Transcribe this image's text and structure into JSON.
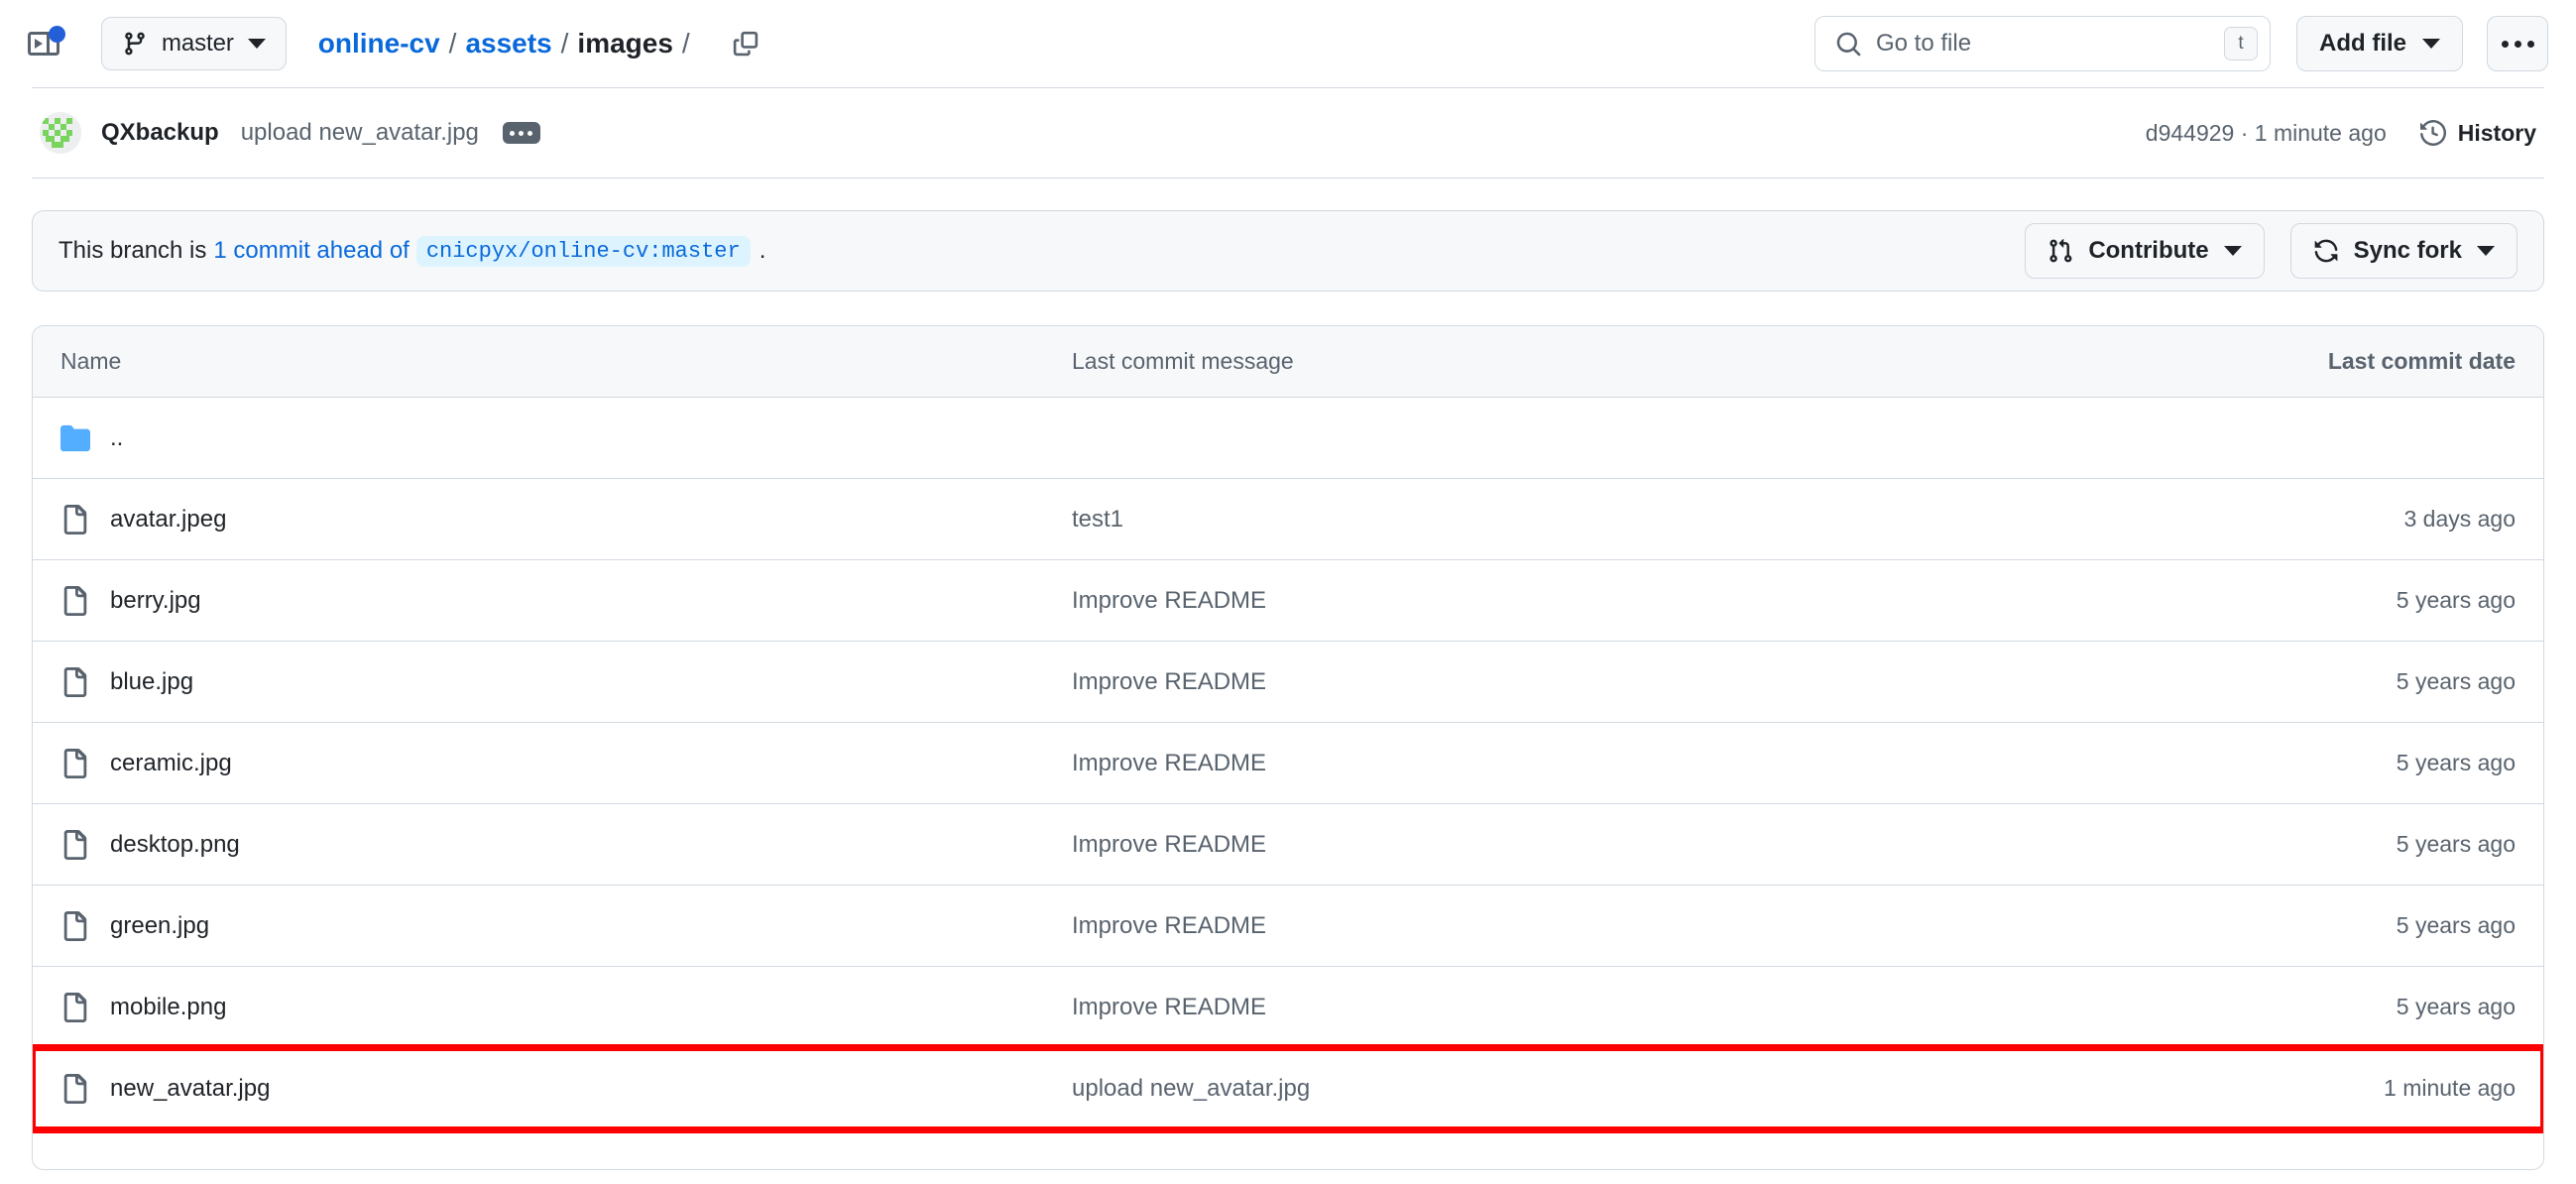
{
  "topbar": {
    "sidebar_toggle_icon": "sidebar-expand-icon",
    "notification_dot_color": "#2360d8",
    "branch": {
      "icon": "git-branch-icon",
      "label": "master"
    },
    "breadcrumb": {
      "parts": [
        {
          "label": "online-cv",
          "type": "link"
        },
        {
          "label": "assets",
          "type": "link"
        },
        {
          "label": "images",
          "type": "current"
        }
      ],
      "separator": "/",
      "trailing_separator": "/"
    },
    "copy_path_icon": "copy-icon",
    "search": {
      "icon": "search-icon",
      "placeholder": "Go to file",
      "shortcut_key": "t"
    },
    "add_file": {
      "label": "Add file",
      "caret_icon": "chevron-down-icon"
    },
    "more_label": "•••"
  },
  "commit": {
    "avatar_alt": "QXbackup avatar identicon",
    "author": "QXbackup",
    "message": "upload new_avatar.jpg",
    "expand_icon": "ellipsis-icon",
    "hash": "d944929",
    "separator": "·",
    "relative_time": "1 minute ago",
    "meta": "d944929 · 1 minute ago",
    "history": {
      "icon": "history-icon",
      "label": "History"
    }
  },
  "banner": {
    "prefix": "This branch is",
    "ahead_link": "1 commit ahead of",
    "upstream": "cnicpyx/online-cv:master",
    "suffix": ".",
    "contribute": {
      "icon": "git-pull-request-icon",
      "label": "Contribute",
      "caret_icon": "chevron-down-icon"
    },
    "sync_fork": {
      "icon": "sync-icon",
      "label": "Sync fork",
      "caret_icon": "chevron-down-icon"
    }
  },
  "filetable": {
    "headers": {
      "name": "Name",
      "message": "Last commit message",
      "date": "Last commit date"
    },
    "rows": [
      {
        "icon": "folder-icon",
        "name": "..",
        "message": "",
        "date": "",
        "highlighted": false
      },
      {
        "icon": "file-icon",
        "name": "avatar.jpeg",
        "message": "test1",
        "date": "3 days ago",
        "highlighted": false
      },
      {
        "icon": "file-icon",
        "name": "berry.jpg",
        "message": "Improve README",
        "date": "5 years ago",
        "highlighted": false
      },
      {
        "icon": "file-icon",
        "name": "blue.jpg",
        "message": "Improve README",
        "date": "5 years ago",
        "highlighted": false
      },
      {
        "icon": "file-icon",
        "name": "ceramic.jpg",
        "message": "Improve README",
        "date": "5 years ago",
        "highlighted": false
      },
      {
        "icon": "file-icon",
        "name": "desktop.png",
        "message": "Improve README",
        "date": "5 years ago",
        "highlighted": false
      },
      {
        "icon": "file-icon",
        "name": "green.jpg",
        "message": "Improve README",
        "date": "5 years ago",
        "highlighted": false
      },
      {
        "icon": "file-icon",
        "name": "mobile.png",
        "message": "Improve README",
        "date": "5 years ago",
        "highlighted": false
      },
      {
        "icon": "file-icon",
        "name": "new_avatar.jpg",
        "message": "upload new_avatar.jpg",
        "date": "1 minute ago",
        "highlighted": true
      }
    ]
  },
  "colors": {
    "link_blue": "#0969da",
    "folder_blue": "#54aeff",
    "highlight_red": "#ff0000",
    "muted_text": "#59636e",
    "border": "#d1d9e0",
    "surface": "#f6f8fa"
  }
}
